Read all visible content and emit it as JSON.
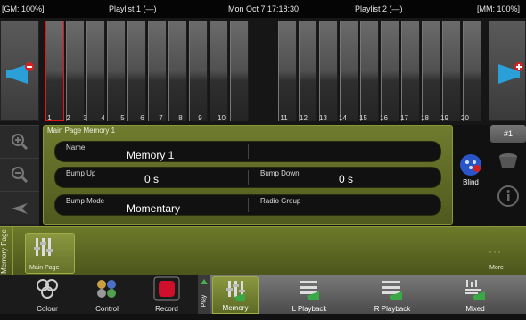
{
  "status": {
    "gm": "[GM: 100%]",
    "playlist1": "Playlist 1 (—)",
    "datetime": "Mon Oct 7 17:18:30",
    "playlist2": "Playlist 2 (—)",
    "mm": "[MM: 100%]"
  },
  "faders": {
    "left_numbers": [
      "1",
      "2",
      "3",
      "4",
      "5",
      "6",
      "7",
      "8",
      "9",
      "10"
    ],
    "right_numbers": [
      "11",
      "12",
      "13",
      "14",
      "15",
      "16",
      "17",
      "18",
      "19",
      "20"
    ],
    "selected": "1"
  },
  "memory_panel": {
    "title": "Main Page Memory 1",
    "name_label": "Name",
    "name_value": "Memory 1",
    "bump_up_label": "Bump Up",
    "bump_up_value": "0 s",
    "bump_down_label": "Bump Down",
    "bump_down_value": "0 s",
    "bump_mode_label": "Bump Mode",
    "bump_mode_value": "Momentary",
    "radio_group_label": "Radio Group",
    "radio_group_value": ""
  },
  "right_column": {
    "page_badge": "#1",
    "blind_label": "Blind"
  },
  "page_bar": {
    "vertical_label": "Memory Page",
    "main_page_label": "Main Page",
    "more_label": "More"
  },
  "bottom_bar": {
    "buttons": [
      "Colour",
      "Control",
      "Record"
    ],
    "tab_vertical": "Play",
    "tabs": [
      "Memory",
      "L Playback",
      "R Playback",
      "Mixed"
    ]
  },
  "colors": {
    "accent_olive": "#6f7c2e",
    "selected_red": "#e01818",
    "record_red": "#d0102a"
  }
}
